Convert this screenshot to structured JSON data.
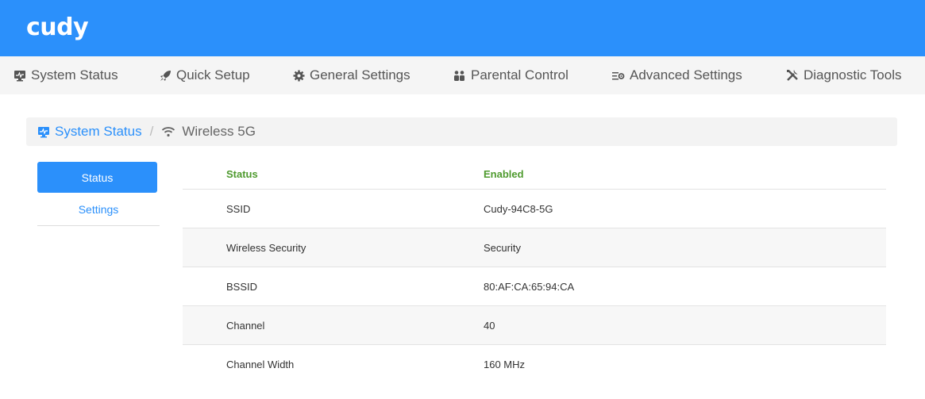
{
  "header": {
    "logo": "cudy"
  },
  "nav": [
    {
      "label": "System Status",
      "icon": "monitor-icon"
    },
    {
      "label": "Quick Setup",
      "icon": "rocket-icon"
    },
    {
      "label": "General Settings",
      "icon": "gear-icon"
    },
    {
      "label": "Parental Control",
      "icon": "family-icon"
    },
    {
      "label": "Advanced Settings",
      "icon": "advanced-settings-icon"
    },
    {
      "label": "Diagnostic Tools",
      "icon": "tools-icon"
    }
  ],
  "breadcrumb": {
    "parent": "System Status",
    "separator": "/",
    "current": "Wireless 5G"
  },
  "sidebar": {
    "active": "Status",
    "link": "Settings"
  },
  "table": {
    "header": {
      "key": "Status",
      "value": "Enabled"
    },
    "rows": [
      {
        "key": "SSID",
        "value": "Cudy-94C8-5G"
      },
      {
        "key": "Wireless Security",
        "value": "Security"
      },
      {
        "key": "BSSID",
        "value": "80:AF:CA:65:94:CA"
      },
      {
        "key": "Channel",
        "value": "40"
      },
      {
        "key": "Channel Width",
        "value": "160 MHz"
      }
    ]
  },
  "colors": {
    "brand": "#2b90fb",
    "status_ok": "#4e9a2e"
  }
}
